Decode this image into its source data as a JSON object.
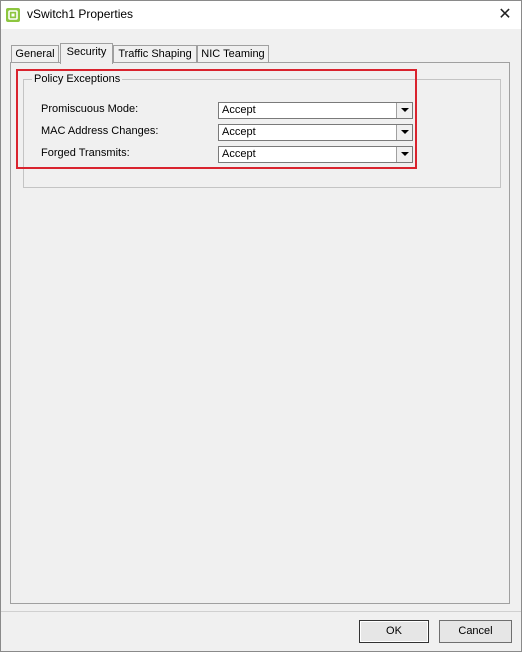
{
  "window": {
    "title": "vSwitch1 Properties"
  },
  "tabs": [
    {
      "label": "General"
    },
    {
      "label": "Security",
      "active": true
    },
    {
      "label": "Traffic Shaping"
    },
    {
      "label": "NIC Teaming"
    }
  ],
  "security": {
    "group_title": "Policy Exceptions",
    "rows": [
      {
        "label": "Promiscuous Mode:",
        "value": "Accept"
      },
      {
        "label": "MAC Address Changes:",
        "value": "Accept"
      },
      {
        "label": "Forged Transmits:",
        "value": "Accept"
      }
    ]
  },
  "buttons": {
    "ok": "OK",
    "cancel": "Cancel"
  },
  "colors": {
    "highlight": "#d9232e",
    "app_icon": "#8dc63f"
  },
  "icons": {
    "app": "vsphere-app-icon",
    "close": "close-icon",
    "dropdown": "dropdown-arrow-icon"
  }
}
